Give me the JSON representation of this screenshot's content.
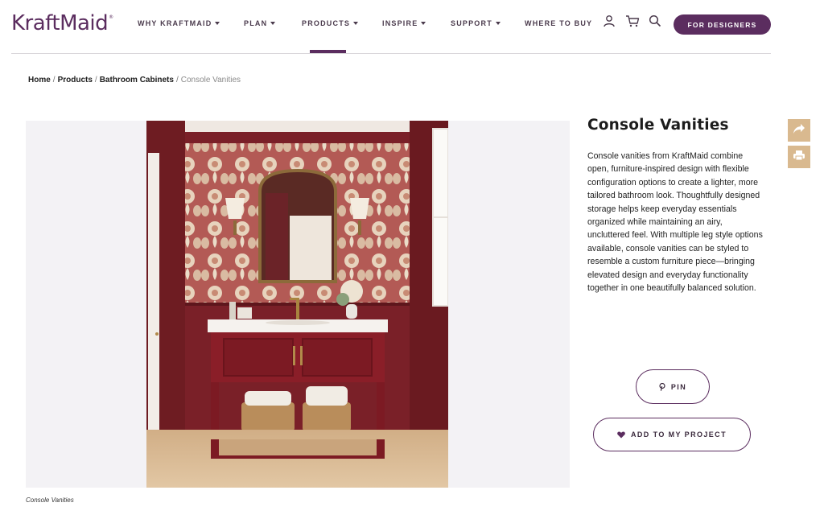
{
  "brand": {
    "logo_text": "KraftMaid",
    "trademark": "®",
    "accent_color": "#5b2d5f",
    "tool_color": "#d9b98f"
  },
  "nav": {
    "items": [
      {
        "label": "WHY KRAFTMAID",
        "has_dropdown": true
      },
      {
        "label": "PLAN",
        "has_dropdown": true
      },
      {
        "label": "PRODUCTS",
        "has_dropdown": true,
        "active": true
      },
      {
        "label": "INSPIRE",
        "has_dropdown": true
      },
      {
        "label": "SUPPORT",
        "has_dropdown": true
      },
      {
        "label": "WHERE TO BUY",
        "has_dropdown": false
      }
    ],
    "icons": [
      "user-icon",
      "cart-icon",
      "search-icon"
    ],
    "designers_label": "FOR DESIGNERS"
  },
  "breadcrumb": {
    "items": [
      "Home",
      "Products",
      "Bathroom Cabinets"
    ],
    "current": "Console Vanities",
    "separator": "/"
  },
  "product": {
    "title": "Console Vanities",
    "description": "Console vanities from KraftMaid combine open, furniture-inspired design with flexible configuration options to create a lighter, more tailored bathroom look. Thoughtfully designed storage helps keep everyday essentials organized while maintaining an airy, uncluttered feel. With multiple leg style options available, console vanities can be styled to resemble a custom furniture piece—bringing elevated design and everyday functionality together in one beautifully balanced solution.",
    "image_caption": "Console Vanities"
  },
  "actions": {
    "pin_label": "PIN",
    "project_label": "ADD TO MY PROJECT"
  },
  "side_tools": [
    "share-icon",
    "print-icon"
  ]
}
